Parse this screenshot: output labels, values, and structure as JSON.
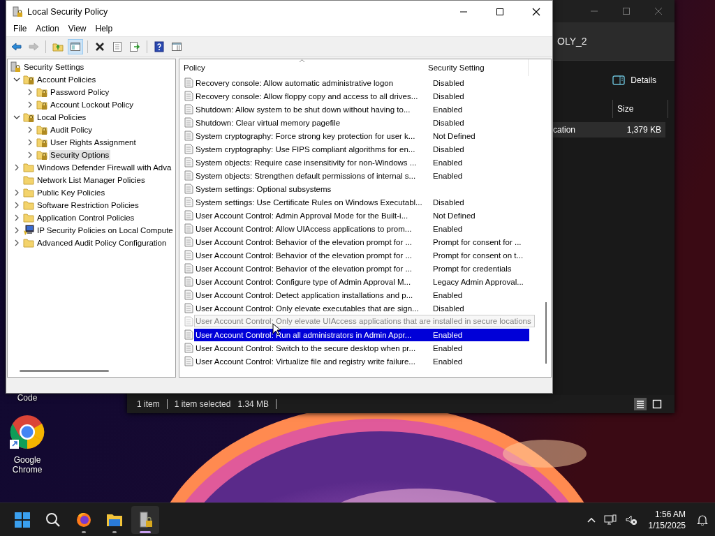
{
  "desktop": {
    "icons": [
      {
        "label": "Code",
        "kind": "hidden"
      },
      {
        "label": "Google Chrome",
        "kind": "chrome"
      }
    ]
  },
  "explorer": {
    "address": "OLY_2",
    "details_button": "Details",
    "columns": [
      "Size"
    ],
    "rows": [
      {
        "name": "cation",
        "size": "1,379 KB",
        "selected": true
      }
    ],
    "status": {
      "count": "1 item",
      "selection": "1 item selected",
      "size": "1.34 MB"
    },
    "views": [
      {
        "kind": "details",
        "selected": true
      },
      {
        "kind": "tiles",
        "selected": false
      }
    ]
  },
  "window": {
    "title": "Local Security Policy",
    "menu": [
      "File",
      "Action",
      "View",
      "Help"
    ],
    "toolbar": [
      {
        "kind": "back",
        "disabled": false,
        "pressed": false
      },
      {
        "kind": "forward",
        "disabled": true,
        "pressed": false
      },
      {
        "kind": "up",
        "disabled": false,
        "pressed": false
      },
      {
        "kind": "tree",
        "disabled": false,
        "pressed": true
      },
      {
        "kind": "delete",
        "disabled": false,
        "pressed": false
      },
      {
        "kind": "properties",
        "disabled": false,
        "pressed": false
      },
      {
        "kind": "export",
        "disabled": false,
        "pressed": false
      },
      {
        "kind": "help",
        "disabled": false,
        "pressed": false
      },
      {
        "kind": "pane",
        "disabled": false,
        "pressed": false
      }
    ],
    "tree": [
      {
        "label": "Security Settings",
        "kind": "root",
        "selected": false,
        "children": [
          {
            "label": "Account Policies",
            "kind": "secure-folder",
            "expandable": true,
            "expanded": true,
            "selected": false,
            "children": [
              {
                "label": "Password Policy",
                "kind": "secure-folder",
                "expandable": true,
                "expanded": false,
                "selected": false
              },
              {
                "label": "Account Lockout Policy",
                "kind": "secure-folder",
                "expandable": true,
                "expanded": false,
                "selected": false
              }
            ]
          },
          {
            "label": "Local Policies",
            "kind": "secure-folder",
            "expandable": true,
            "expanded": true,
            "selected": false,
            "children": [
              {
                "label": "Audit Policy",
                "kind": "secure-folder",
                "expandable": true,
                "expanded": false,
                "selected": false
              },
              {
                "label": "User Rights Assignment",
                "kind": "secure-folder",
                "expandable": true,
                "expanded": false,
                "selected": false
              },
              {
                "label": "Security Options",
                "kind": "secure-folder",
                "expandable": true,
                "expanded": false,
                "selected": true
              }
            ]
          },
          {
            "label": "Windows Defender Firewall with Adva",
            "kind": "folder",
            "expandable": true,
            "expanded": false,
            "selected": false
          },
          {
            "label": "Network List Manager Policies",
            "kind": "folder",
            "expandable": false,
            "selected": false
          },
          {
            "label": "Public Key Policies",
            "kind": "folder",
            "expandable": true,
            "expanded": false,
            "selected": false
          },
          {
            "label": "Software Restriction Policies",
            "kind": "folder",
            "expandable": true,
            "expanded": false,
            "selected": false
          },
          {
            "label": "Application Control Policies",
            "kind": "folder",
            "expandable": true,
            "expanded": false,
            "selected": false
          },
          {
            "label": "IP Security Policies on Local Compute",
            "kind": "computer",
            "expandable": true,
            "expanded": false,
            "selected": false
          },
          {
            "label": "Advanced Audit Policy Configuration",
            "kind": "folder",
            "expandable": true,
            "expanded": false,
            "selected": false
          }
        ]
      }
    ],
    "list": {
      "columns": [
        "Policy",
        "Security Setting"
      ],
      "rows": [
        {
          "policy": "Recovery console: Allow automatic administrative logon",
          "setting": "Disabled",
          "selected": false
        },
        {
          "policy": "Recovery console: Allow floppy copy and access to all drives...",
          "setting": "Disabled",
          "selected": false
        },
        {
          "policy": "Shutdown: Allow system to be shut down without having to...",
          "setting": "Enabled",
          "selected": false
        },
        {
          "policy": "Shutdown: Clear virtual memory pagefile",
          "setting": "Disabled",
          "selected": false
        },
        {
          "policy": "System cryptography: Force strong key protection for user k...",
          "setting": "Not Defined",
          "selected": false
        },
        {
          "policy": "System cryptography: Use FIPS compliant algorithms for en...",
          "setting": "Disabled",
          "selected": false
        },
        {
          "policy": "System objects: Require case insensitivity for non-Windows ...",
          "setting": "Enabled",
          "selected": false
        },
        {
          "policy": "System objects: Strengthen default permissions of internal s...",
          "setting": "Enabled",
          "selected": false
        },
        {
          "policy": "System settings: Optional subsystems",
          "selected": false
        },
        {
          "policy": "System settings: Use Certificate Rules on Windows Executabl...",
          "setting": "Disabled",
          "selected": false
        },
        {
          "policy": "User Account Control: Admin Approval Mode for the Built-i...",
          "setting": "Not Defined",
          "selected": false
        },
        {
          "policy": "User Account Control: Allow UIAccess applications to prom...",
          "setting": "Enabled",
          "selected": false
        },
        {
          "policy": "User Account Control: Behavior of the elevation prompt for ...",
          "setting": "Prompt for consent for ...",
          "selected": false
        },
        {
          "policy": "User Account Control: Behavior of the elevation prompt for ...",
          "setting": "Prompt for consent on t...",
          "selected": false
        },
        {
          "policy": "User Account Control: Behavior of the elevation prompt for ...",
          "setting": "Prompt for credentials",
          "selected": false
        },
        {
          "policy": "User Account Control: Configure type of Admin Approval M...",
          "setting": "Legacy Admin Approval...",
          "selected": false
        },
        {
          "policy": "User Account Control: Detect application installations and p...",
          "setting": "Enabled",
          "selected": false
        },
        {
          "policy": "User Account Control: Only elevate executables that are sign...",
          "setting": "Disabled",
          "selected": false
        },
        {
          "tooltip": "User Account Control: Only elevate UIAccess applications that are installed in secure locations"
        },
        {
          "policy": "User Account Control: Run all administrators in Admin Appr...",
          "setting": "Enabled",
          "selected": true
        },
        {
          "policy": "User Account Control: Switch to the secure desktop when pr...",
          "setting": "Enabled",
          "selected": false
        },
        {
          "policy": "User Account Control: Virtualize file and registry write failure...",
          "setting": "Enabled",
          "selected": false
        }
      ]
    }
  },
  "taskbar": {
    "apps": [
      {
        "kind": "start",
        "running": false,
        "active": false
      },
      {
        "kind": "search",
        "running": false,
        "active": false
      },
      {
        "kind": "firefox",
        "running": true,
        "active": false
      },
      {
        "kind": "files",
        "running": true,
        "active": false
      },
      {
        "kind": "security-policy",
        "running": true,
        "active": true
      }
    ],
    "time": "1:56 AM",
    "date": "1/15/2025"
  }
}
